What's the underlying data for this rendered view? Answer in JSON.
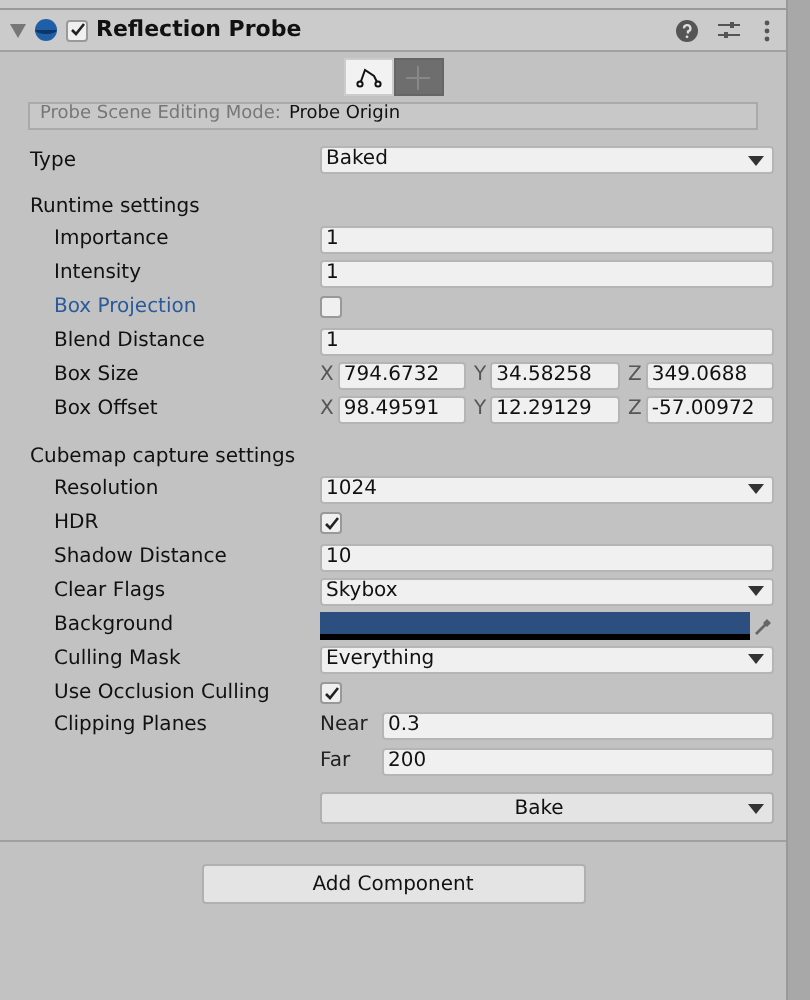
{
  "component": {
    "title": "Reflection Probe",
    "enabled": true,
    "expanded": true
  },
  "edit_mode_buttons": [
    {
      "kind": "edit-bounds",
      "selected": true
    },
    {
      "kind": "move-origin",
      "selected": false
    }
  ],
  "editing_mode": {
    "label": "Probe Scene Editing Mode:",
    "value": "Probe Origin"
  },
  "type_row": {
    "label": "Type",
    "value": "Baked"
  },
  "sections": [
    {
      "title": "Runtime settings",
      "rows": [
        {
          "kind": "text",
          "label": "Importance",
          "value": "1",
          "overridden": false
        },
        {
          "kind": "text",
          "label": "Intensity",
          "value": "1",
          "overridden": false
        },
        {
          "kind": "checkbox",
          "label": "Box Projection",
          "checked": false,
          "overridden": true
        },
        {
          "kind": "text",
          "label": "Blend Distance",
          "value": "1",
          "overridden": false
        },
        {
          "kind": "vector3",
          "label": "Box Size",
          "axes": [
            {
              "name": "X",
              "value": "794.6732"
            },
            {
              "name": "Y",
              "value": "34.58258"
            },
            {
              "name": "Z",
              "value": "349.0688"
            }
          ],
          "overridden": false
        },
        {
          "kind": "vector3",
          "label": "Box Offset",
          "axes": [
            {
              "name": "X",
              "value": "98.49591"
            },
            {
              "name": "Y",
              "value": "12.29129"
            },
            {
              "name": "Z",
              "value": "-57.00972"
            }
          ],
          "overridden": false
        }
      ]
    },
    {
      "title": "Cubemap capture settings",
      "rows": [
        {
          "kind": "dropdown",
          "label": "Resolution",
          "value": "1024",
          "overridden": false
        },
        {
          "kind": "checkbox",
          "label": "HDR",
          "checked": true,
          "overridden": false
        },
        {
          "kind": "text",
          "label": "Shadow Distance",
          "value": "10",
          "overridden": false
        },
        {
          "kind": "dropdown",
          "label": "Clear Flags",
          "value": "Skybox",
          "overridden": false
        },
        {
          "kind": "color",
          "label": "Background",
          "color": "#2d4f7f",
          "overridden": false
        },
        {
          "kind": "dropdown",
          "label": "Culling Mask",
          "value": "Everything",
          "overridden": false
        },
        {
          "kind": "checkbox",
          "label": "Use Occlusion Culling",
          "checked": true,
          "overridden": false
        },
        {
          "kind": "planes",
          "label": "Clipping Planes",
          "planes": [
            {
              "name": "Near",
              "value": "0.3"
            },
            {
              "name": "Far",
              "value": "200"
            }
          ],
          "overridden": false
        }
      ]
    }
  ],
  "bake_button": "Bake",
  "add_component_button": "Add Component"
}
